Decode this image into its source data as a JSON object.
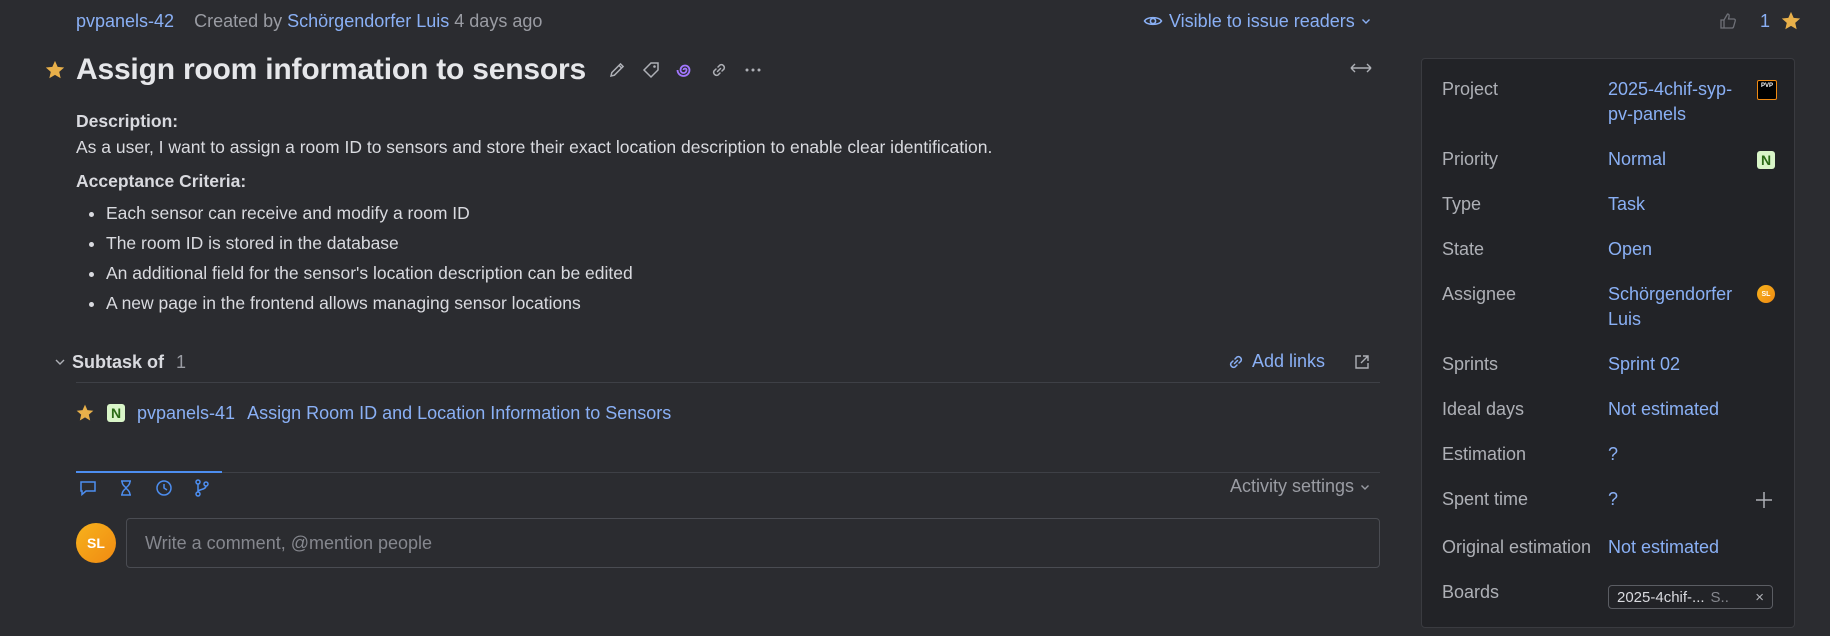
{
  "header": {
    "issue_id": "pvpanels-42",
    "created_by_label": "Created by",
    "author": "Schörgendorfer Luis",
    "created_ago": "4 days ago",
    "visibility": "Visible to issue readers",
    "vote_icon": "thumbs-up-icon",
    "star_count": "1",
    "star_color": "#e8b04a"
  },
  "issue": {
    "title": "Assign room information to sensors",
    "toolbar_icons": [
      "pencil-icon",
      "tag-icon",
      "ai-spiral-icon",
      "link-icon",
      "more-icon"
    ],
    "description_heading": "Description:",
    "description": "As a user, I want to assign a room ID to sensors and store their exact location description to enable clear identification.",
    "criteria_heading": "Acceptance Criteria:",
    "criteria": [
      "Each sensor can receive and modify a room ID",
      "The room ID is stored in the database",
      "An additional field for the sensor's location description can be edited",
      "A new page in the frontend allows managing sensor locations"
    ]
  },
  "links": {
    "section_label": "Subtask of",
    "count": "1",
    "add_links_label": "Add links",
    "items": [
      {
        "badge": "N",
        "id": "pvpanels-41",
        "summary": "Assign Room ID and Location Information to Sensors"
      }
    ]
  },
  "activity": {
    "tabs": [
      "comments-icon",
      "hourglass-icon",
      "clock-icon",
      "branch-icon"
    ],
    "settings_label": "Activity settings",
    "avatar_initials": "SL",
    "comment_placeholder": "Write a comment, @mention people"
  },
  "sidebar": {
    "project_label": "Project",
    "project_value": "2025-4chif-syp-pv-panels",
    "project_icon_text": "PVP",
    "priority_label": "Priority",
    "priority_value": "Normal",
    "priority_badge": "N",
    "type_label": "Type",
    "type_value": "Task",
    "state_label": "State",
    "state_value": "Open",
    "assignee_label": "Assignee",
    "assignee_value": "Schörgendorfer Luis",
    "assignee_initials": "SL",
    "sprints_label": "Sprints",
    "sprints_value": "Sprint 02",
    "ideal_days_label": "Ideal days",
    "ideal_days_value": "Not estimated",
    "estimation_label": "Estimation",
    "estimation_value": "?",
    "spent_time_label": "Spent time",
    "spent_time_value": "?",
    "original_estimation_label": "Original estimation",
    "original_estimation_value": "Not estimated",
    "boards_label": "Boards",
    "board_chip_name": "2025-4chif-...",
    "board_chip_sub": "S..",
    "board_chip_close": "×"
  }
}
